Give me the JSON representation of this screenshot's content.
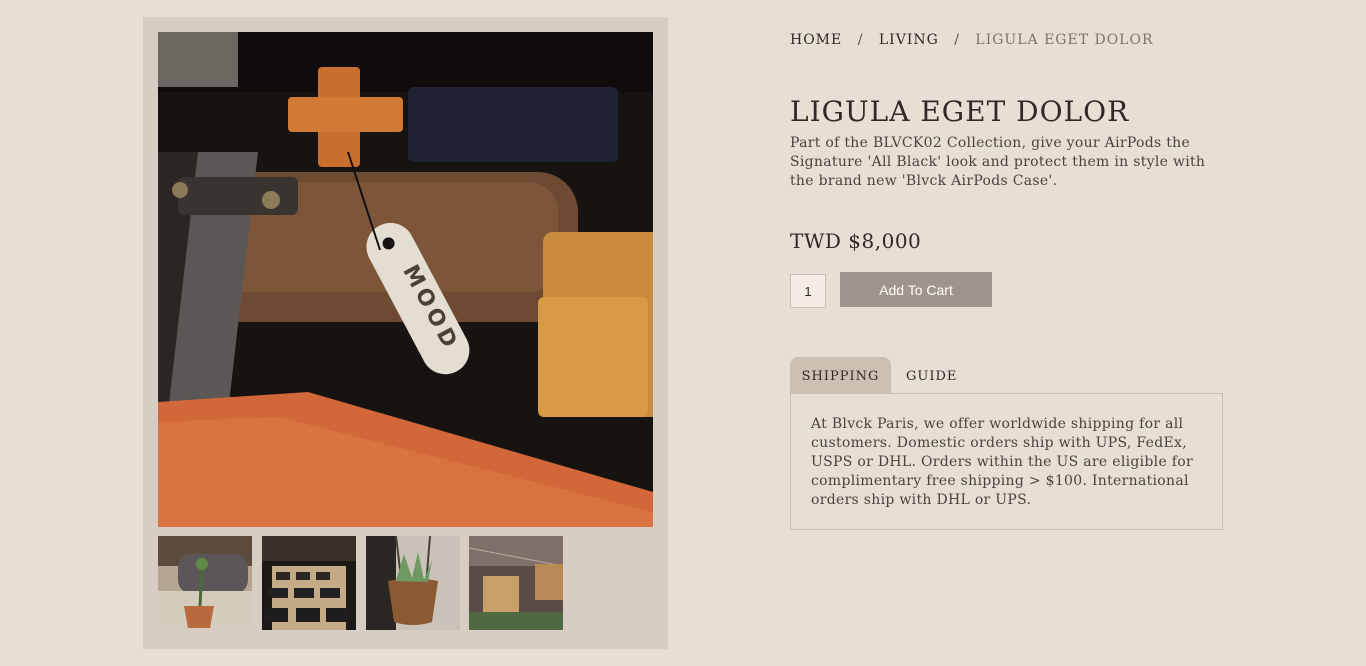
{
  "breadcrumb": {
    "home": "HOME",
    "category": "LIVING",
    "current": "LIGULA EGET DOLOR",
    "separator": "/"
  },
  "product": {
    "title": "LIGULA EGET DOLOR",
    "description": "Part of the BLVCK02 Collection, give your AirPods the Signature 'All Black' look and protect them in style with the brand new 'Blvck AirPods Case'.",
    "price": "TWD $8,000",
    "quantity": "1",
    "tag_text": "MOOD"
  },
  "cart": {
    "add_label": "Add To Cart"
  },
  "tabs": {
    "items": [
      {
        "label": "SHIPPING",
        "active": true
      },
      {
        "label": "GUIDE",
        "active": false
      }
    ],
    "shipping_text": "At Blvck Paris, we offer worldwide shipping for all customers. Domestic orders ship with UPS, FedEx, USPS or DHL. Orders within the US are eligible for complimentary free shipping > $100. International orders ship with DHL or UPS."
  },
  "colors": {
    "background": "#e8dfd4",
    "gallery_bg": "#d8cdc2",
    "button": "#a0958c",
    "tab_active": "#cdbfb2"
  },
  "gallery": {
    "thumbnail_count": 4
  }
}
